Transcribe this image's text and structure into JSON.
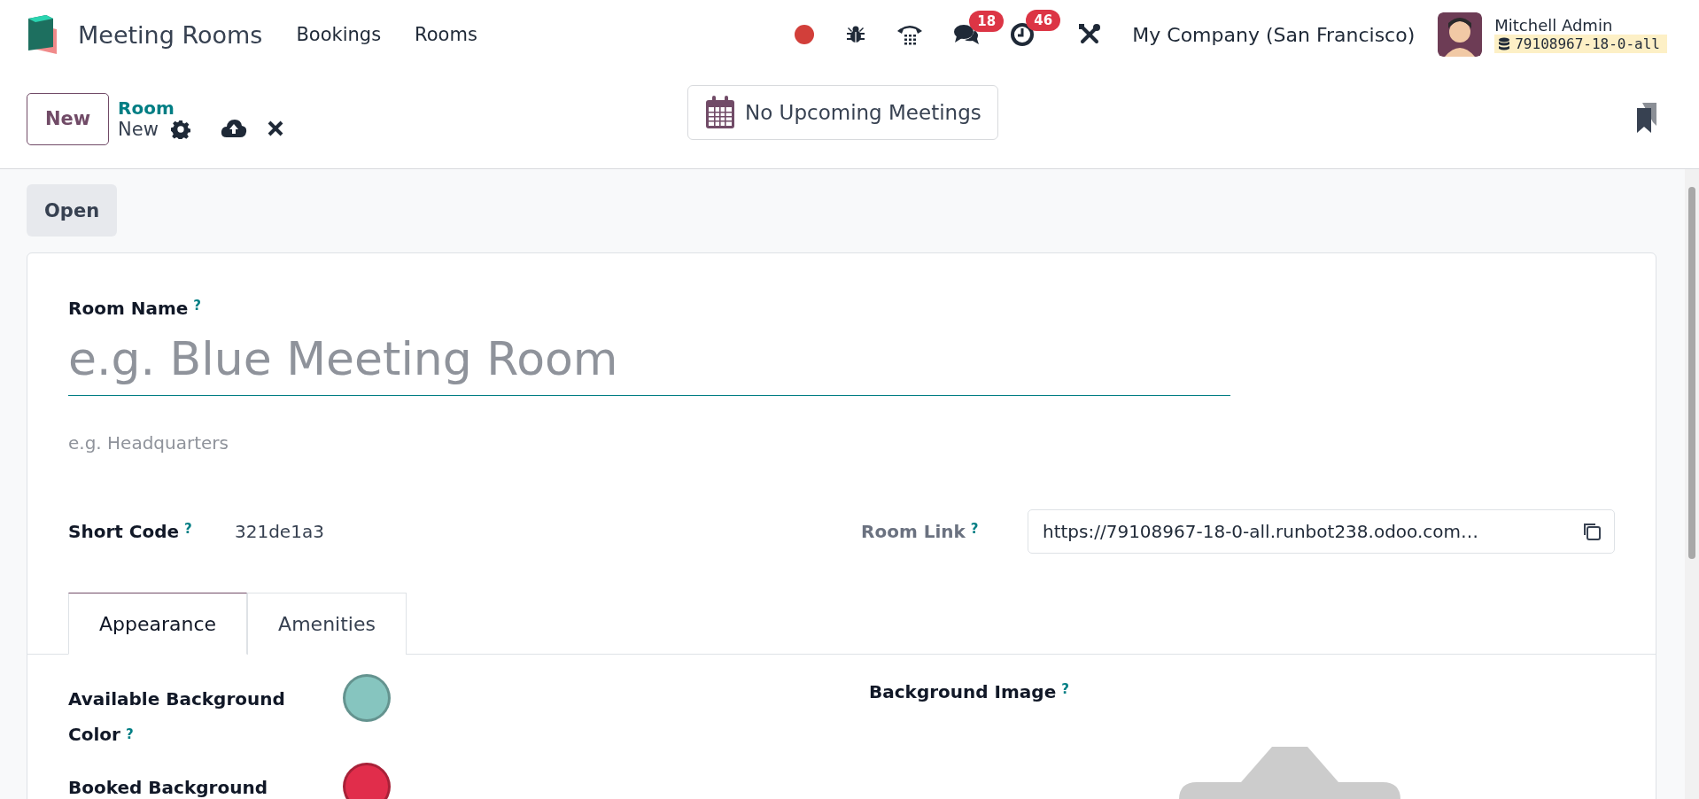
{
  "navbar": {
    "app_name": "Meeting Rooms",
    "menu": [
      "Bookings",
      "Rooms"
    ],
    "messages_badge": "18",
    "activities_badge": "46",
    "company": "My Company (San Francisco)",
    "user": "Mitchell Admin",
    "database": "79108967-18-0-all"
  },
  "control_panel": {
    "new_button": "New",
    "breadcrumb": "Room",
    "record_name": "New",
    "upcoming_button": "No Upcoming Meetings"
  },
  "open_button": "Open",
  "form": {
    "room_name": {
      "label": "Room Name",
      "help": "?",
      "placeholder": "e.g. Blue Meeting Room"
    },
    "location": {
      "placeholder": "e.g. Headquarters"
    },
    "short_code": {
      "label": "Short Code",
      "help": "?",
      "value": "321de1a3"
    },
    "room_link": {
      "label": "Room Link",
      "help": "?",
      "value": "https://79108967-18-0-all.runbot238.odoo.com…"
    }
  },
  "tabs": [
    {
      "label": "Appearance",
      "selected": true
    },
    {
      "label": "Amenities",
      "selected": false
    }
  ],
  "appearance": {
    "colors": [
      {
        "label": "Available Background Color",
        "help": "?",
        "color": "#86c5bf"
      },
      {
        "label": "Booked Background",
        "color": "#e12d4b"
      }
    ],
    "background_image": {
      "label": "Background Image",
      "help": "?"
    }
  }
}
